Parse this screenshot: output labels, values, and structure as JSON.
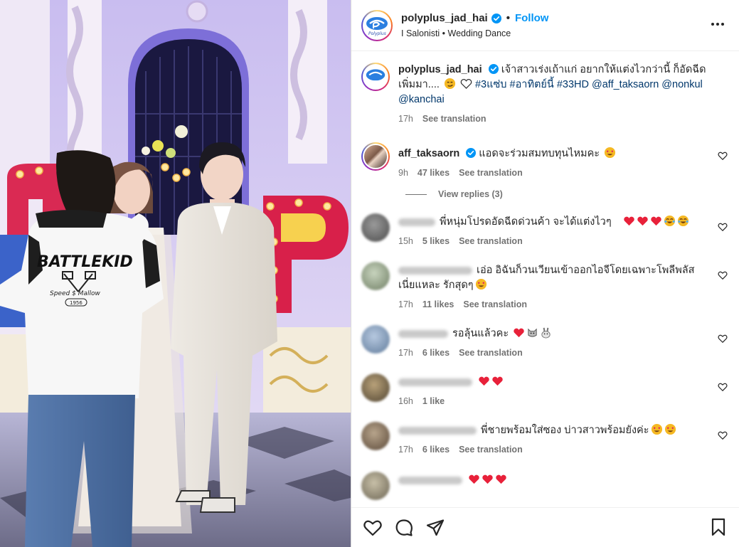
{
  "post": {
    "username": "polyplus_jad_hai",
    "follow_label": "Follow",
    "separator": "•",
    "subtitle": "I Salonisti • Wedding Dance",
    "caption": {
      "username": "polyplus_jad_hai",
      "text": " เจ้าสาวเร่งเถ้าแก่ อยากให้แต่งไวกว่านี้ ก็อัดฉีดเพิ่มมา....",
      "hashtags": "#3แซ่บ #อาทิตย์นี้ #33HD @aff_taksaorn @nonkul @kanchai",
      "time": "17h",
      "see_translation": "See translation"
    },
    "avatar_logo_text": "Polyplus"
  },
  "media": {
    "jacket_text": "BATTLEKID",
    "jacket_subtext": "Speed $ Mallow",
    "jacket_year": "1956"
  },
  "comments": [
    {
      "username": "aff_taksaorn",
      "verified": true,
      "text": "แอดจะร่วมสมทบทุนไหมคะ",
      "emojis": [
        "heart-eyes"
      ],
      "time": "9h",
      "likes": "47 likes",
      "see_translation": "See translation",
      "view_replies": "View replies (3)"
    },
    {
      "username": "",
      "text": "พี่หนุ่มโปรดอัดฉีดด่วนค้า จะได้แต่งไวๆ",
      "emojis": [
        "red-heart",
        "red-heart",
        "red-heart",
        "tears-joy",
        "tears-joy"
      ],
      "time": "15h",
      "likes": "5 likes",
      "see_translation": "See translation"
    },
    {
      "username": "",
      "text": "เอ่อ อิฉันก็วนเวียนเข้าออกไอจีโดยเฉพาะโพลีพลัสเนี่ยแหละ รักสุดๆ",
      "emojis": [
        "heart-eyes"
      ],
      "time": "17h",
      "likes": "11 likes",
      "see_translation": "See translation"
    },
    {
      "username": "",
      "text": "รอลุ้นแล้วคะ",
      "emojis": [
        "red-heart",
        "cat",
        "rabbit"
      ],
      "time": "17h",
      "likes": "6 likes",
      "see_translation": "See translation"
    },
    {
      "username": "",
      "text": "",
      "emojis": [
        "red-heart",
        "red-heart"
      ],
      "time": "16h",
      "likes": "1 like",
      "see_translation": ""
    },
    {
      "username": "",
      "text": "พี่ชายพร้อมใส่ซอง บ่าวสาวพร้อมยังค่ะ",
      "emojis": [
        "heart-eyes",
        "heart-eyes"
      ],
      "time": "17h",
      "likes": "6 likes",
      "see_translation": "See translation"
    }
  ],
  "colors": {
    "accent": "#0095f6",
    "link": "#00376b",
    "muted": "#737373",
    "text": "#262626",
    "red": "#ed4956"
  }
}
